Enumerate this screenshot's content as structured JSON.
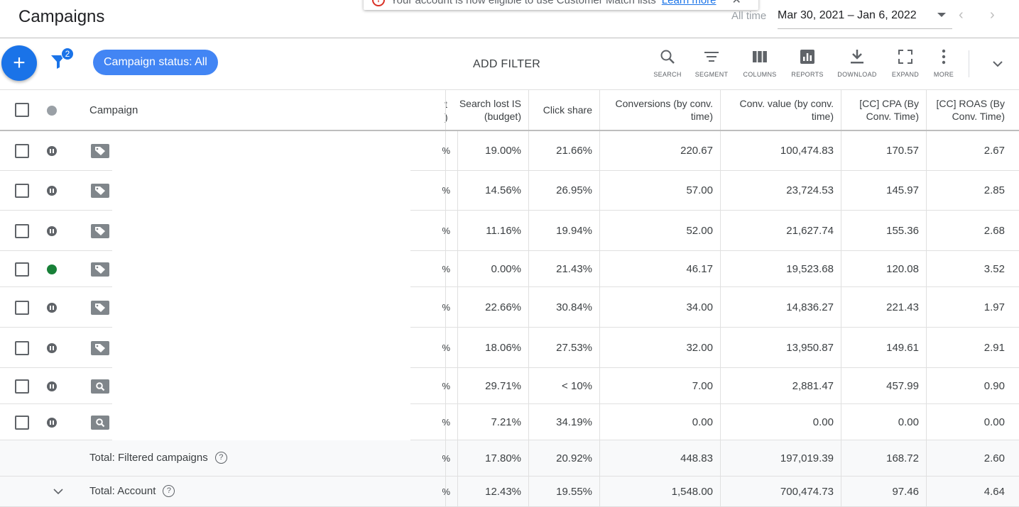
{
  "header": {
    "title": "Campaigns",
    "notice": {
      "text": "Your account is now eligible to use Customer Match lists",
      "link": "Learn more"
    },
    "date_label": "All time",
    "date_range": "Mar 30, 2021 – Jan 6, 2022"
  },
  "toolbar": {
    "filter_count": "2",
    "status_chip": "Campaign status: All",
    "add_filter": "ADD FILTER",
    "tools": [
      "SEARCH",
      "SEGMENT",
      "COLUMNS",
      "REPORTS",
      "DOWNLOAD",
      "EXPAND",
      "MORE"
    ]
  },
  "table": {
    "campaign_header": "Campaign",
    "clipped_header": "t )",
    "columns": [
      "Search lost IS (budget)",
      "Click share",
      "Conversions (by conv. time)",
      "Conv. value (by conv. time)",
      "[CC] CPA (By Conv. Time)",
      "[CC] ROAS (By Conv. Time)"
    ],
    "rows": [
      {
        "status": "paused",
        "type": "shopping",
        "clip": "%",
        "values": [
          "19.00%",
          "21.66%",
          "220.67",
          "100,474.83",
          "170.57",
          "2.67"
        ]
      },
      {
        "status": "paused",
        "type": "shopping",
        "clip": "%",
        "values": [
          "14.56%",
          "26.95%",
          "57.00",
          "23,724.53",
          "145.97",
          "2.85"
        ]
      },
      {
        "status": "paused",
        "type": "shopping",
        "clip": "%",
        "values": [
          "11.16%",
          "19.94%",
          "52.00",
          "21,627.74",
          "155.36",
          "2.68"
        ]
      },
      {
        "status": "enabled",
        "type": "shopping",
        "clip": "%",
        "values": [
          "0.00%",
          "21.43%",
          "46.17",
          "19,523.68",
          "120.08",
          "3.52"
        ]
      },
      {
        "status": "paused",
        "type": "shopping",
        "clip": "%",
        "values": [
          "22.66%",
          "30.84%",
          "34.00",
          "14,836.27",
          "221.43",
          "1.97"
        ]
      },
      {
        "status": "paused",
        "type": "shopping",
        "clip": "%",
        "values": [
          "18.06%",
          "27.53%",
          "32.00",
          "13,950.87",
          "149.61",
          "2.91"
        ]
      },
      {
        "status": "paused",
        "type": "search",
        "clip": "%",
        "values": [
          "29.71%",
          "< 10%",
          "7.00",
          "2,881.47",
          "457.99",
          "0.90"
        ]
      },
      {
        "status": "paused",
        "type": "search",
        "clip": "%",
        "values": [
          "7.21%",
          "34.19%",
          "0.00",
          "0.00",
          "0.00",
          "0.00"
        ]
      }
    ],
    "totals": [
      {
        "label": "Total: Filtered campaigns",
        "clip": "%",
        "values": [
          "17.80%",
          "20.92%",
          "448.83",
          "197,019.39",
          "168.72",
          "2.60"
        ]
      },
      {
        "label": "Total: Account",
        "clip": "%",
        "values": [
          "12.43%",
          "19.55%",
          "1,548.00",
          "700,474.73",
          "97.46",
          "4.64"
        ]
      }
    ]
  }
}
